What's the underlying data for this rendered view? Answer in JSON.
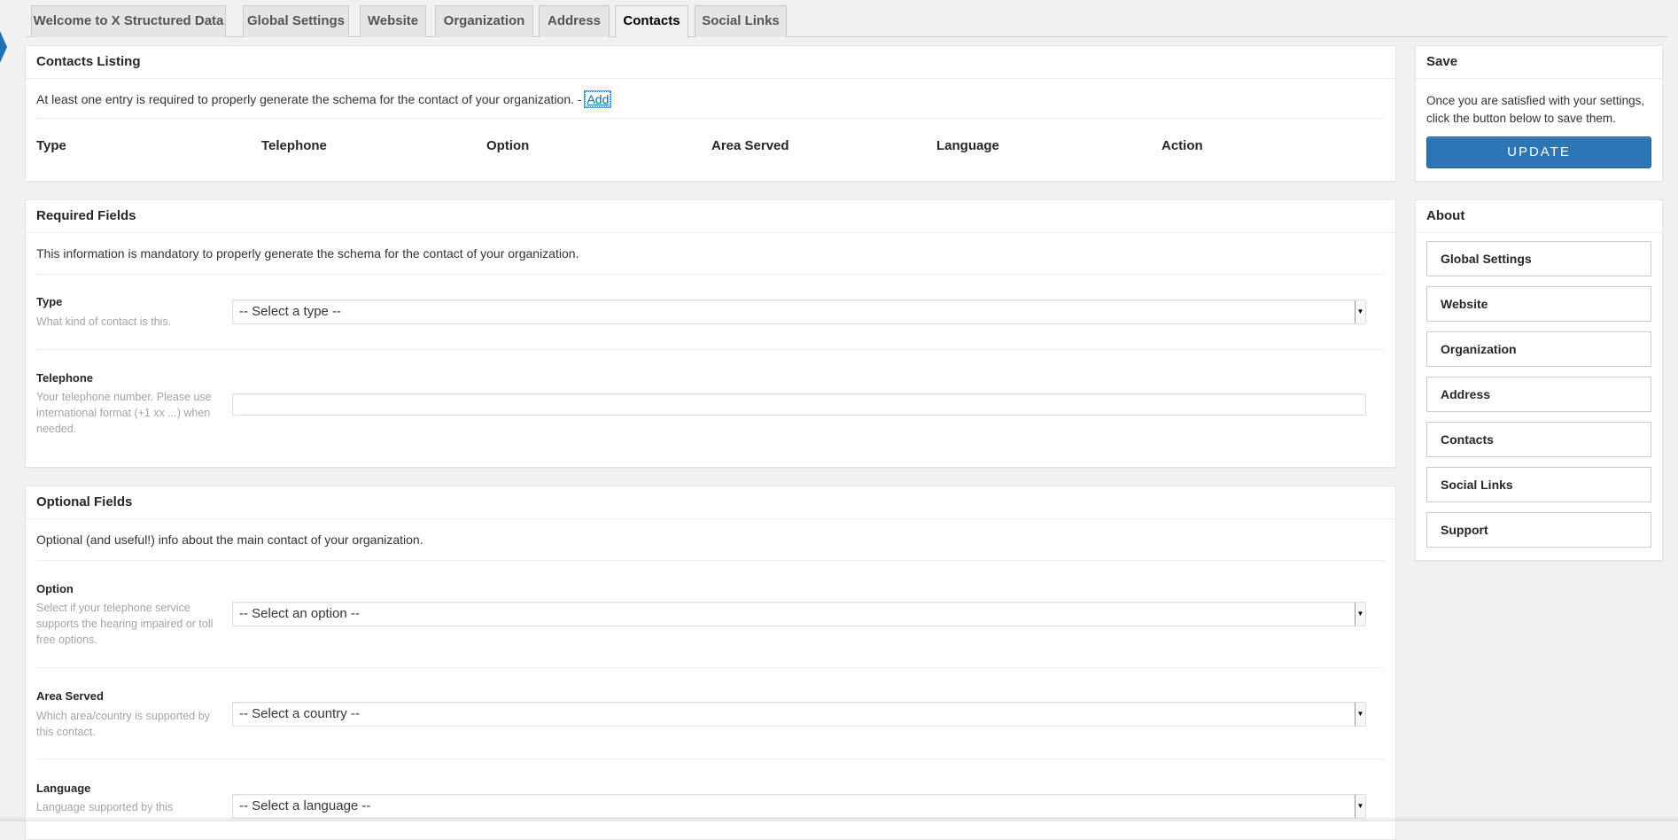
{
  "tabs": [
    {
      "label": "Welcome to X Structured Data"
    },
    {
      "label": "Global Settings"
    },
    {
      "label": "Website"
    },
    {
      "label": "Organization"
    },
    {
      "label": "Address"
    },
    {
      "label": "Contacts",
      "active": true
    },
    {
      "label": "Social Links"
    }
  ],
  "contacts_listing": {
    "title": "Contacts Listing",
    "intro": "At least one entry is required to properly generate the schema for the contact of your organization. -",
    "add_label": "Add",
    "columns": [
      "Type",
      "Telephone",
      "Option",
      "Area Served",
      "Language",
      "Action"
    ]
  },
  "required": {
    "title": "Required Fields",
    "intro": "This information is mandatory to properly generate the schema for the contact of your organization.",
    "type_label": "Type",
    "type_desc": "What kind of contact is this.",
    "type_select": "-- Select a type --",
    "telephone_label": "Telephone",
    "telephone_desc": "Your telephone number. Please use international format (+1 xx ...) when needed.",
    "telephone_value": ""
  },
  "optional": {
    "title": "Optional Fields",
    "intro": "Optional (and useful!) info about the main contact of your organization.",
    "option_label": "Option",
    "option_desc": "Select if your telephone service supports the hearing impaired or toll free options.",
    "option_select": "-- Select an option --",
    "area_label": "Area Served",
    "area_desc": "Which area/country is supported by this contact.",
    "area_select": "-- Select a country --",
    "language_label": "Language",
    "language_desc": "Language supported by this",
    "language_select": "-- Select a language --"
  },
  "save": {
    "title": "Save",
    "text": "Once you are satisfied with your settings, click the button below to save them.",
    "button": "UPDATE"
  },
  "about": {
    "title": "About",
    "links": [
      "Global Settings",
      "Website",
      "Organization",
      "Address",
      "Contacts",
      "Social Links",
      "Support"
    ]
  },
  "icons": {
    "select_arrow": "▼"
  },
  "colors": {
    "accent": "#2e75b5",
    "background": "#f1f1f1"
  }
}
